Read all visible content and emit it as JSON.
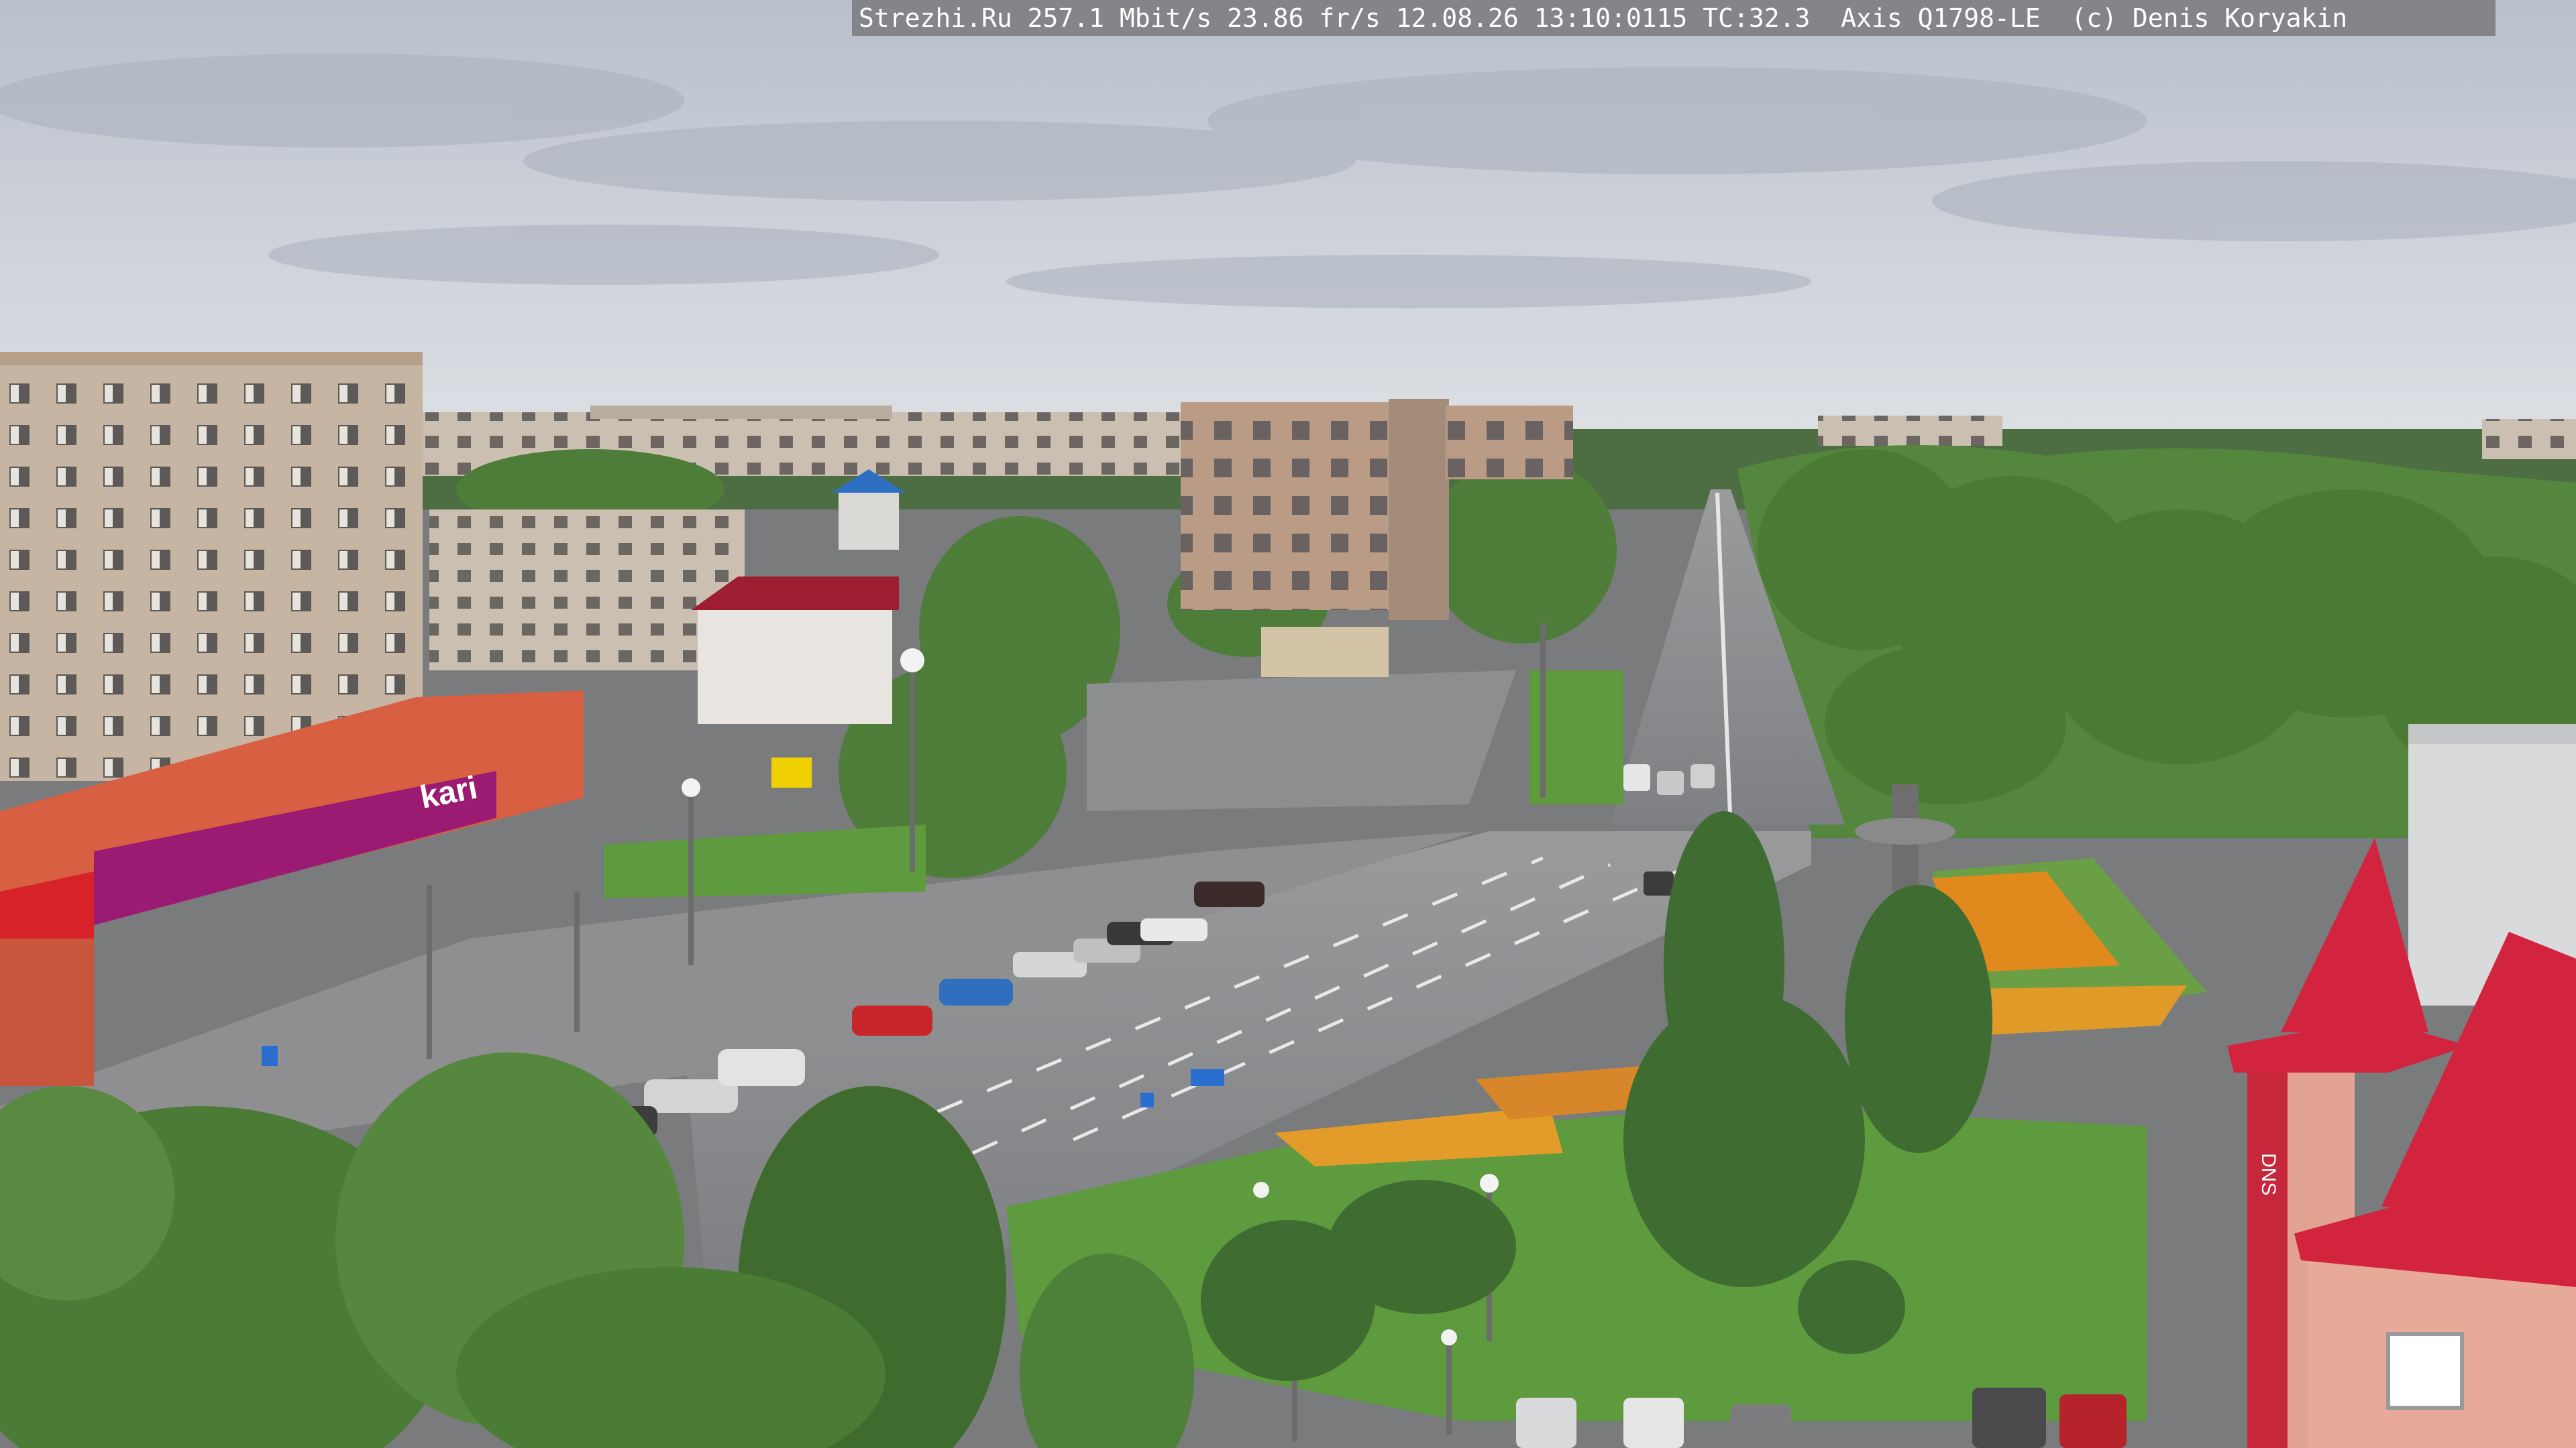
{
  "overlay": {
    "text": "Strezhi.Ru 257.1 Mbit/s 23.86 fr/s 12.08.26 13:10:0115 TC:32.3  Axis Q1798-LE  (c) Denis Koryakin"
  },
  "signage": {
    "store_logo": "kari",
    "dns_logo": "DNS"
  },
  "colors": {
    "sky": "#c6ccd6",
    "building_brick": "#c9b8a8",
    "asphalt": "#8a8b8d",
    "trees": "#4f7a3c",
    "lawn": "#5e9a3e",
    "store_magenta": "#9b1a72",
    "roof_red": "#d2243e",
    "flowerbed": "#e08a1e"
  }
}
